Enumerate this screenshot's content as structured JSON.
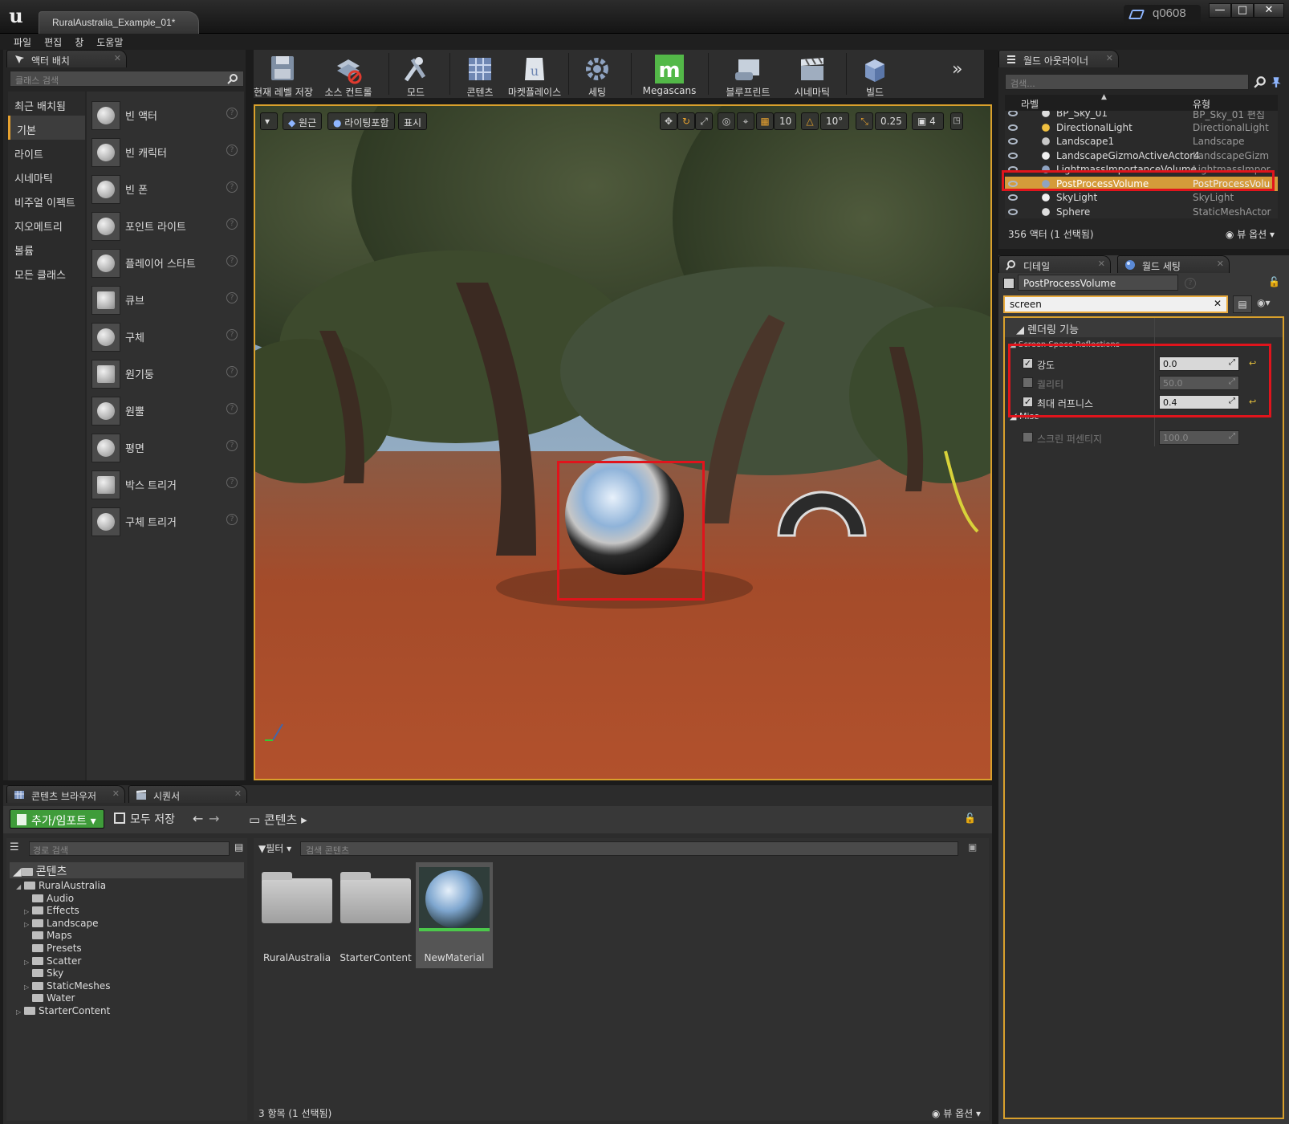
{
  "titlebar": {
    "doc_tab": "RuralAustralia_Example_01*",
    "user": "q0608",
    "min": "—",
    "max": "□",
    "close": "✕"
  },
  "menu": [
    "파일",
    "편집",
    "창",
    "도움말"
  ],
  "place_actors": {
    "tab": "액터 배치",
    "search_placeholder": "클래스 검색",
    "categories": [
      "최근 배치됨",
      "기본",
      "라이트",
      "시네마틱",
      "비주얼 이펙트",
      "지오메트리",
      "볼륨",
      "모든 클래스"
    ],
    "selected_category": "기본",
    "items": [
      "빈 액터",
      "빈 캐릭터",
      "빈 폰",
      "포인트 라이트",
      "플레이어 스타트",
      "큐브",
      "구체",
      "원기둥",
      "원뿔",
      "평면",
      "박스 트리거",
      "구체 트리거"
    ],
    "help_glyph": "?"
  },
  "toolbar": {
    "items": [
      "현재 레벨 저장",
      "소스 컨트롤",
      "모드",
      "콘텐츠",
      "마켓플레이스",
      "세팅",
      "Megascans",
      "블루프린트",
      "시네마틱",
      "빌드"
    ],
    "overflow": "»"
  },
  "viewport": {
    "menu_glyph": "▾",
    "perspective": "원근",
    "lit": "라이팅포함",
    "show": "표시",
    "grid_snap": "10",
    "rot_snap": "10°",
    "scale_snap": "0.25",
    "cam_speed": "4"
  },
  "outliner": {
    "tab": "월드 아웃라이너",
    "search_placeholder": "검색...",
    "col_label": "라벨",
    "col_type": "유형",
    "rows": [
      {
        "label": "BP_Sky_01",
        "type": "BP_Sky_01 편집"
      },
      {
        "label": "DirectionalLight",
        "type": "DirectionalLight"
      },
      {
        "label": "Landscape1",
        "type": "Landscape"
      },
      {
        "label": "LandscapeGizmoActiveActor4",
        "type": "LandscapeGizm"
      },
      {
        "label": "LightmassImportanceVolume",
        "type": "LightmassImpor"
      },
      {
        "label": "PostProcessVolume",
        "type": "PostProcessVolu"
      },
      {
        "label": "SkyLight",
        "type": "SkyLight"
      },
      {
        "label": "Sphere",
        "type": "StaticMeshActor"
      }
    ],
    "selected_index": 5,
    "footer": "356 액터 (1 선택됨)",
    "view_options": "뷰 옵션"
  },
  "details": {
    "tab": "디테일",
    "tab2": "월드 세팅",
    "object_name": "PostProcessVolume",
    "filter_value": "screen",
    "clear_glyph": "✕",
    "category": "렌더링 기능",
    "subcategory": "Screen Space Reflections",
    "props": [
      {
        "name": "강도",
        "value": "0.0",
        "checked": true,
        "enabled": true
      },
      {
        "name": "퀄리티",
        "value": "50.0",
        "checked": false,
        "enabled": false
      },
      {
        "name": "최대 러프니스",
        "value": "0.4",
        "checked": true,
        "enabled": true
      }
    ],
    "misc": "Misc",
    "misc_props": [
      {
        "name": "스크린 퍼센티지",
        "value": "100.0",
        "checked": false,
        "enabled": false
      }
    ]
  },
  "content_browser": {
    "tab": "콘텐츠 브라우저",
    "tab2": "시퀀서",
    "add_import": "추가/임포트",
    "save_all": "모두 저장",
    "path": "콘텐츠",
    "path_search_placeholder": "경로 검색",
    "tree_root": "콘텐츠",
    "tree": [
      {
        "label": "RuralAustralia",
        "depth": 1,
        "arrow": "◢"
      },
      {
        "label": "Audio",
        "depth": 2,
        "arrow": ""
      },
      {
        "label": "Effects",
        "depth": 2,
        "arrow": "▷"
      },
      {
        "label": "Landscape",
        "depth": 2,
        "arrow": "▷"
      },
      {
        "label": "Maps",
        "depth": 2,
        "arrow": ""
      },
      {
        "label": "Presets",
        "depth": 2,
        "arrow": ""
      },
      {
        "label": "Scatter",
        "depth": 2,
        "arrow": "▷"
      },
      {
        "label": "Sky",
        "depth": 2,
        "arrow": ""
      },
      {
        "label": "StaticMeshes",
        "depth": 2,
        "arrow": "▷"
      },
      {
        "label": "Water",
        "depth": 2,
        "arrow": ""
      },
      {
        "label": "StarterContent",
        "depth": 1,
        "arrow": "▷"
      }
    ],
    "filter": "필터",
    "asset_search_placeholder": "검색 콘텐츠",
    "assets": [
      "RuralAustralia",
      "StarterContent",
      "NewMaterial"
    ],
    "selected_asset": 2,
    "footer": "3 항목 (1 선택됨)",
    "view_options": "뷰 옵션"
  },
  "colors": {
    "accent": "#d9a02c",
    "selection": "#d49b3a",
    "highlight_box": "#e0141c",
    "import_green": "#3f9c3a"
  }
}
